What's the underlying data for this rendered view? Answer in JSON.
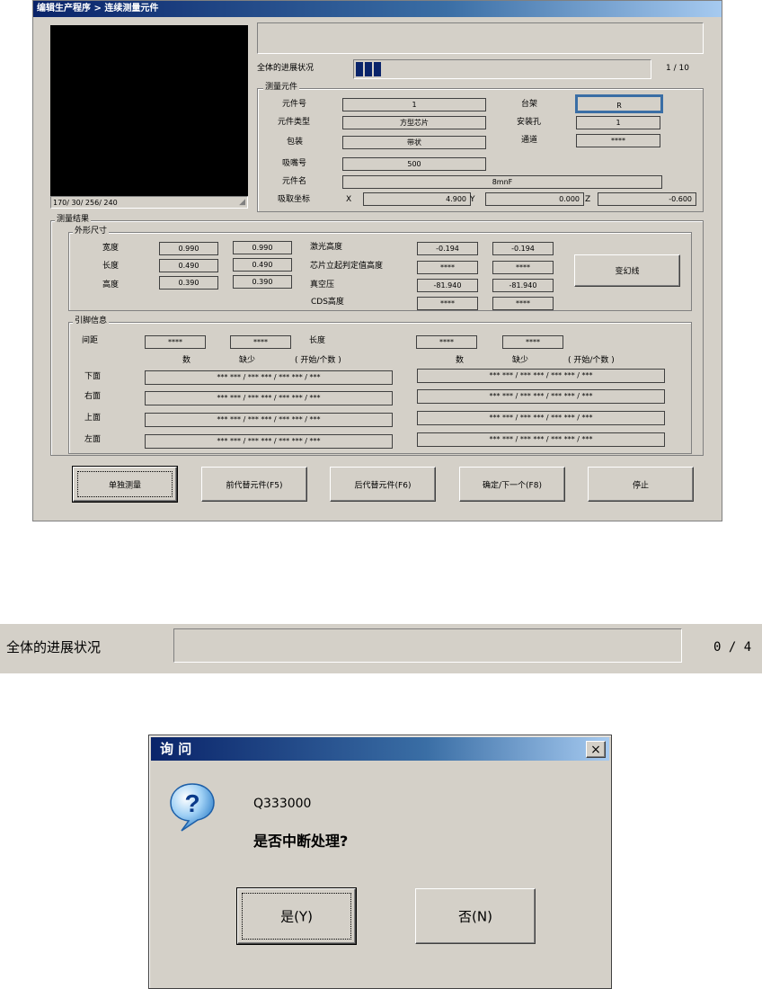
{
  "window": {
    "title": "编辑生产程序 > 连续测量元件",
    "camera_readout": "170/ 30/ 256/ 240"
  },
  "progress": {
    "label": "全体的进展状况",
    "count": "1 / 10",
    "fraction": 0.1
  },
  "component": {
    "group_label": "测量元件",
    "rows": [
      {
        "label": "元件号",
        "value": "1"
      },
      {
        "label": "元件类型",
        "value": "方型芯片"
      },
      {
        "label": "包装",
        "value": "带状"
      },
      {
        "label": "吸嘴号",
        "value": "500"
      },
      {
        "label": "元件名",
        "value": "8mnF"
      }
    ],
    "right_rows": [
      {
        "label": "台架",
        "value": "R"
      },
      {
        "label": "安装孔",
        "value": "1"
      },
      {
        "label": "通道",
        "value": "****"
      }
    ],
    "pickup": {
      "label": "吸取坐标",
      "x_label": "X",
      "x": "4.900",
      "y_label": "Y",
      "y": "0.000",
      "z_label": "Z",
      "z": "-0.600"
    }
  },
  "results": {
    "group_label": "测量结果",
    "outer": {
      "group_label": "外形尺寸",
      "dims": [
        {
          "label": "宽度",
          "v1": "0.990",
          "v2": "0.990"
        },
        {
          "label": "长度",
          "v1": "0.490",
          "v2": "0.490"
        },
        {
          "label": "高度",
          "v1": "0.390",
          "v2": "0.390"
        }
      ],
      "metrics": [
        {
          "label": "激光高度",
          "v1": "-0.194",
          "v2": "-0.194"
        },
        {
          "label": "芯片立起判定值高度",
          "v1": "****",
          "v2": "****"
        },
        {
          "label": "真空压",
          "v1": "-81.940",
          "v2": "-81.940"
        },
        {
          "label": "CDS高度",
          "v1": "****",
          "v2": "****"
        }
      ],
      "change_button": "变幻线"
    },
    "leads": {
      "group_label": "引脚信息",
      "pitch_label": "间距",
      "pitch_v1": "****",
      "pitch_v2": "****",
      "length_label": "长度",
      "length_v1": "****",
      "length_v2": "****",
      "head_num": "数",
      "head_missing": "缺少",
      "head_open": "( 开始/个数 )",
      "sides": [
        {
          "label": "下面",
          "left": "*** *** / *** *** / *** *** / ***",
          "right": "*** *** / *** *** / *** *** / ***"
        },
        {
          "label": "右面",
          "left": "*** *** / *** *** / *** *** / ***",
          "right": "*** *** / *** *** / *** *** / ***"
        },
        {
          "label": "上面",
          "left": "*** *** / *** *** / *** *** / ***",
          "right": "*** *** / *** *** / *** *** / ***"
        },
        {
          "label": "左面",
          "left": "*** *** / *** *** / *** *** / ***",
          "right": "*** *** / *** *** / *** *** / ***"
        }
      ]
    }
  },
  "buttons": {
    "single": "单独测量",
    "prev": "前代替元件(F5)",
    "next": "后代替元件(F6)",
    "confirm": "确定/下一个(F8)",
    "stop": "停止"
  },
  "strip": {
    "label": "全体的进展状况",
    "count": "0 / 4"
  },
  "dialog": {
    "title": "询 问",
    "close": "×",
    "icon": "question-icon",
    "code": "Q333000",
    "message": "是否中断处理?",
    "yes": "是(Y)",
    "no": "否(N)"
  }
}
